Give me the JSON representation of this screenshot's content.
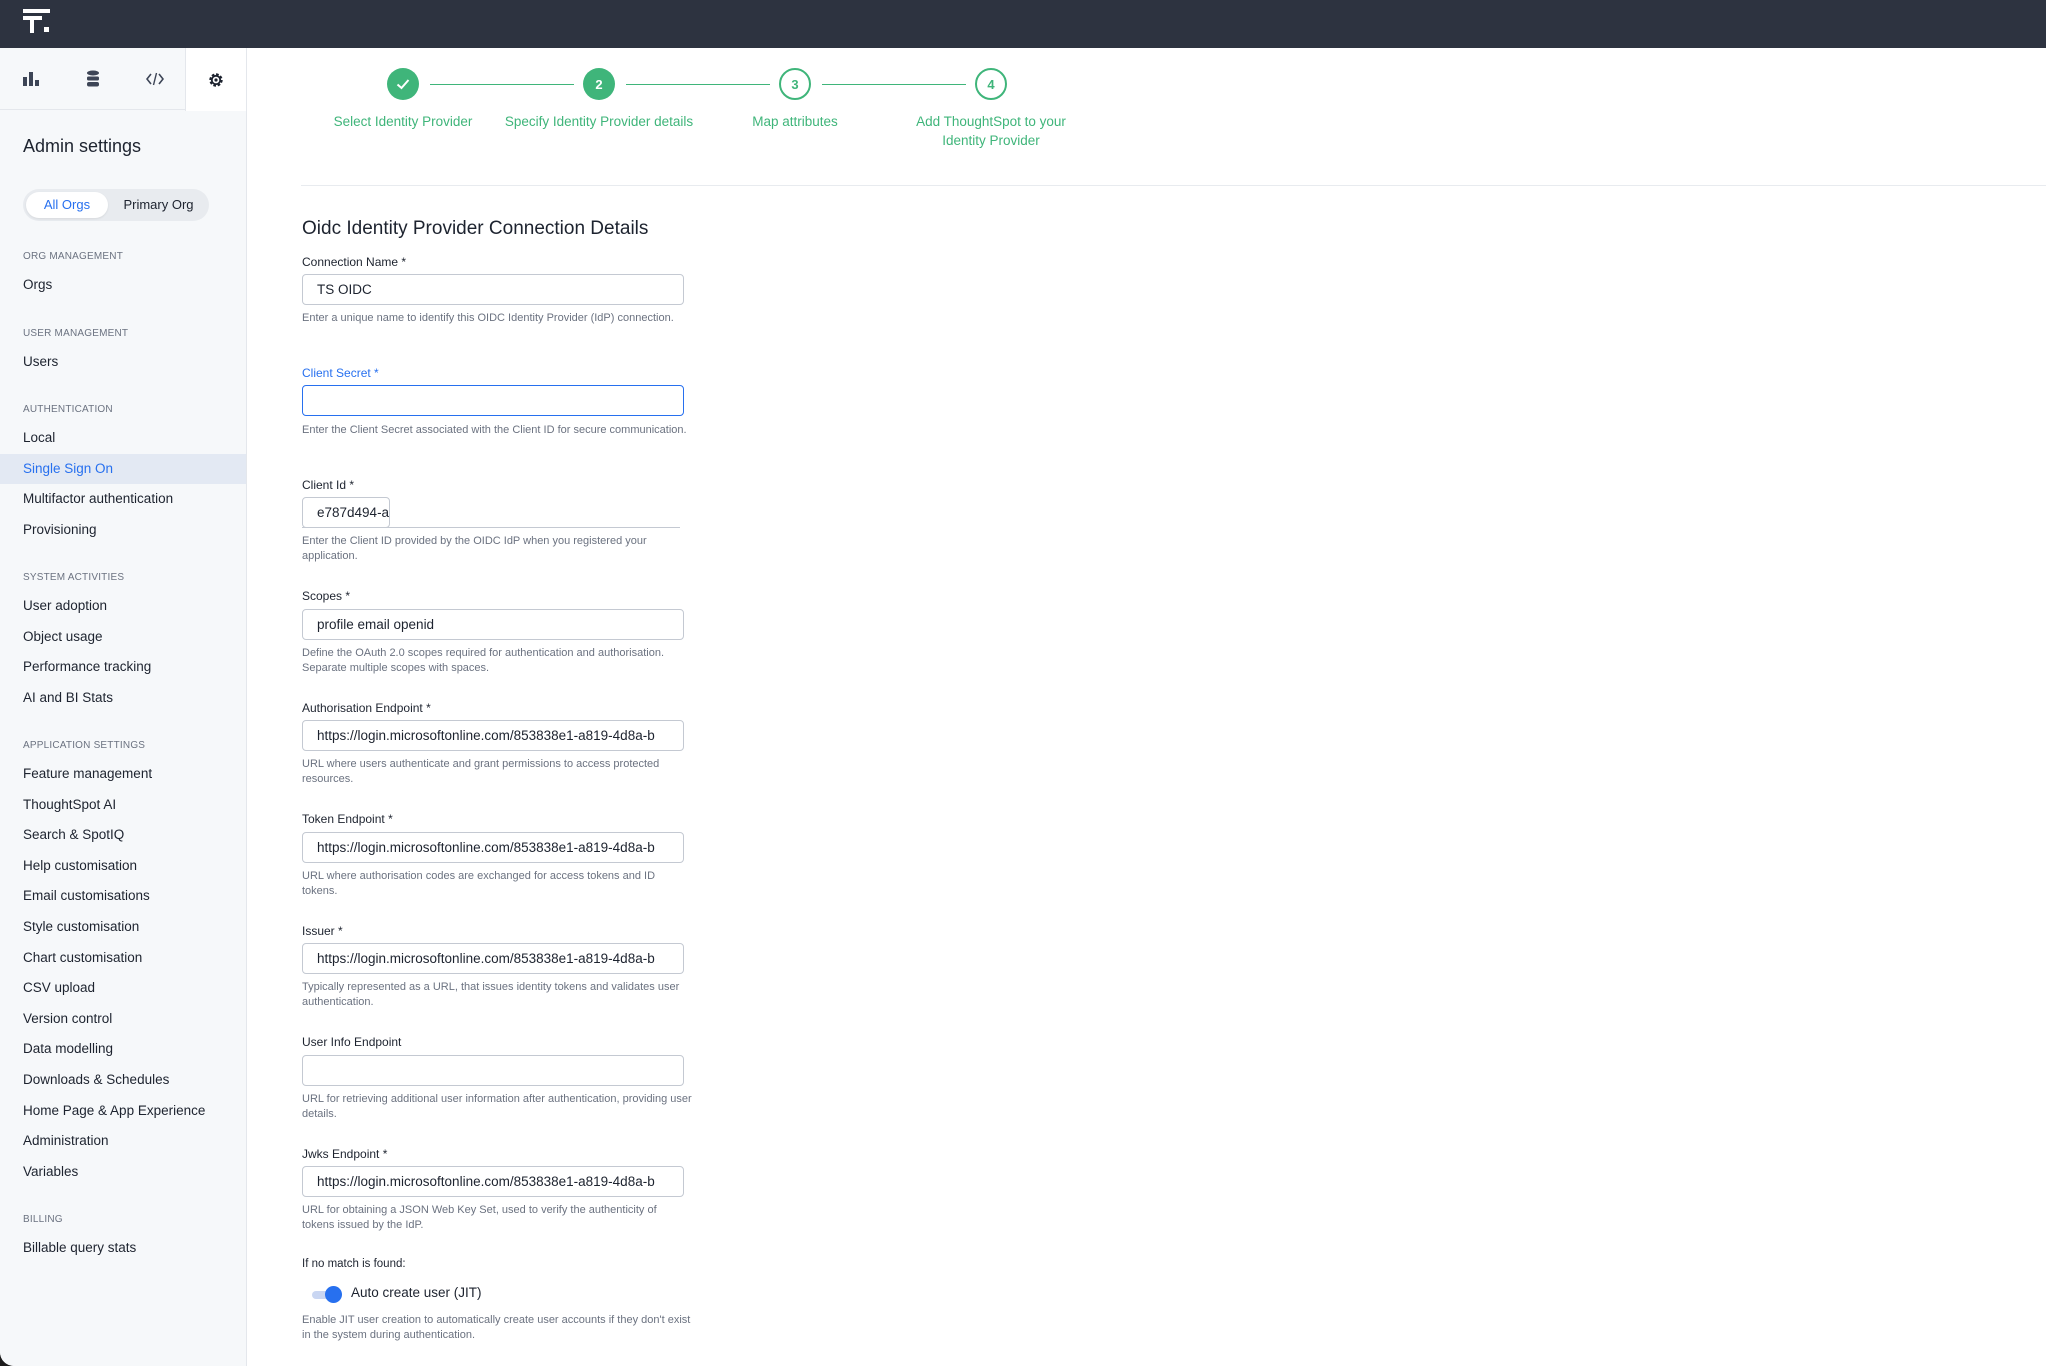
{
  "sidebar": {
    "icon_tabs": [
      {
        "icon": "bar-chart-icon"
      },
      {
        "icon": "database-icon"
      },
      {
        "icon": "code-icon"
      },
      {
        "icon": "gear-icon"
      }
    ],
    "title": "Admin settings",
    "org_toggle": {
      "options": [
        "All Orgs",
        "Primary Org"
      ],
      "selected": "All Orgs"
    },
    "sections": {
      "org_management": "ORG MANAGEMENT",
      "user_management": "USER MANAGEMENT",
      "authentication": "AUTHENTICATION",
      "system_activities": "SYSTEM ACTIVITIES",
      "application_settings": "APPLICATION SETTINGS",
      "billing": "BILLING"
    },
    "items": {
      "orgs": "Orgs",
      "users": "Users",
      "local": "Local",
      "sso": "Single Sign On",
      "mfa": "Multifactor authentication",
      "provisioning": "Provisioning",
      "user_adoption": "User adoption",
      "object_usage": "Object usage",
      "performance_tracking": "Performance tracking",
      "ai_bi_stats": "AI and BI Stats",
      "feature_management": "Feature management",
      "thoughtspot_ai": "ThoughtSpot AI",
      "search_spotiq": "Search & SpotIQ",
      "help_customisation": "Help customisation",
      "email_customisations": "Email customisations",
      "style_customisation": "Style customisation",
      "chart_customisation": "Chart customisation",
      "csv_upload": "CSV upload",
      "version_control": "Version control",
      "data_modelling": "Data modelling",
      "downloads_schedules": "Downloads & Schedules",
      "home_page": "Home Page & App Experience",
      "administration": "Administration",
      "variables": "Variables",
      "billable_query_stats": "Billable query stats"
    },
    "active_item": "Single Sign On"
  },
  "stepper": {
    "steps": [
      {
        "number": "1",
        "label": "Select Identity Provider",
        "state": "done"
      },
      {
        "number": "2",
        "label": "Specify Identity Provider details",
        "state": "current"
      },
      {
        "number": "3",
        "label": "Map attributes",
        "state": "todo"
      },
      {
        "number": "4",
        "label_line1": "Add ThoughtSpot to your",
        "label_line2": "Identity Provider",
        "state": "todo"
      }
    ],
    "colors": {
      "accent": "#3fb57a"
    }
  },
  "form": {
    "title": "Oidc Identity Provider Connection Details",
    "connection_name": {
      "label": "Connection Name *",
      "value": "TS OIDC",
      "help": "Enter a unique name to identify this OIDC Identity Provider (IdP) connection."
    },
    "client_secret": {
      "label": "Client Secret *",
      "value": "",
      "help": "Enter the Client Secret associated with the Client ID for secure communication."
    },
    "client_id": {
      "label": "Client Id *",
      "value": "e787d494-a",
      "help": "Enter the Client ID provided by the OIDC IdP when you registered your application."
    },
    "scopes": {
      "label": "Scopes *",
      "value": "profile email openid",
      "help": "Define the OAuth 2.0 scopes required for authentication and authorisation. Separate multiple scopes with spaces."
    },
    "authorisation_endpoint": {
      "label": "Authorisation Endpoint *",
      "value": "https://login.microsoftonline.com/853838e1-a819-4d8a-b",
      "help": "URL where users authenticate and grant permissions to access protected resources."
    },
    "token_endpoint": {
      "label": "Token Endpoint *",
      "value": "https://login.microsoftonline.com/853838e1-a819-4d8a-b",
      "help": "URL where authorisation codes are exchanged for access tokens and ID tokens."
    },
    "issuer": {
      "label": "Issuer *",
      "value": "https://login.microsoftonline.com/853838e1-a819-4d8a-b",
      "help": "Typically represented as a URL, that issues identity tokens and validates user authentication."
    },
    "user_info_endpoint": {
      "label": "User Info Endpoint",
      "value": "",
      "help": "URL for retrieving additional user information after authentication, providing user details."
    },
    "jwks_endpoint": {
      "label": "Jwks Endpoint *",
      "value": "https://login.microsoftonline.com/853838e1-a819-4d8a-b",
      "help": "URL for obtaining a JSON Web Key Set, used to verify the authenticity of tokens issued by the IdP."
    },
    "no_match": {
      "label": "If no match is found:",
      "toggle_label": "Auto create user (JIT)",
      "toggle_on": true,
      "help": "Enable JIT user creation to automatically create user accounts if they don't exist in the system during authentication."
    }
  },
  "colors": {
    "brand_blue": "#2770ef",
    "topbar": "#2d3340",
    "success": "#3fb57a"
  }
}
